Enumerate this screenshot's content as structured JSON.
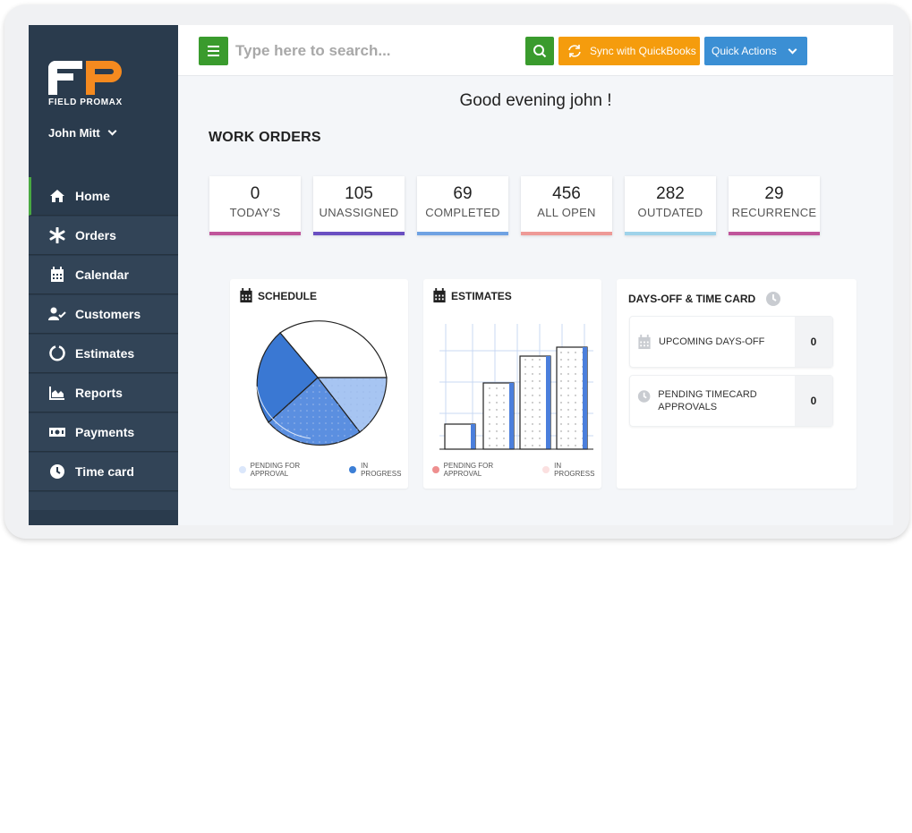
{
  "app": {
    "logo_text": "FIELD PROMAX",
    "user_name": "John Mitt"
  },
  "sidebar": {
    "items": [
      {
        "label": "Home",
        "icon": "home-icon",
        "active": true
      },
      {
        "label": "Orders",
        "icon": "asterisk-icon",
        "active": false
      },
      {
        "label": "Calendar",
        "icon": "calendar-icon",
        "active": false
      },
      {
        "label": "Customers",
        "icon": "user-check-icon",
        "active": false
      },
      {
        "label": "Estimates",
        "icon": "circle-notch-icon",
        "active": false
      },
      {
        "label": "Reports",
        "icon": "area-chart-icon",
        "active": false
      },
      {
        "label": "Payments",
        "icon": "money-bill-icon",
        "active": false
      },
      {
        "label": "Time card",
        "icon": "clock-icon",
        "active": false
      }
    ]
  },
  "topbar": {
    "search_placeholder": "Type here to search...",
    "sync_label": "Sync with QuickBooks",
    "quick_actions_label": "Quick Actions"
  },
  "main": {
    "greeting": "Good evening john !",
    "section_title": "WORK ORDERS",
    "stats": [
      {
        "value": "0",
        "label": "TODAY'S",
        "color": "#c0559b"
      },
      {
        "value": "105",
        "label": "UNASSIGNED",
        "color": "#6a4fc2"
      },
      {
        "value": "69",
        "label": "COMPLETED",
        "color": "#6fa2e3"
      },
      {
        "value": "456",
        "label": "ALL OPEN",
        "color": "#ee9a97"
      },
      {
        "value": "282",
        "label": "OUTDATED",
        "color": "#9fd3ea"
      },
      {
        "value": "29",
        "label": "RECURRENCE",
        "color": "#c0559b"
      }
    ]
  },
  "schedule": {
    "title": "SCHEDULE",
    "legend": [
      {
        "label": "PENDING FOR APPROVAL",
        "color": "#dbe7fb"
      },
      {
        "label": "IN PROGRESS",
        "color": "#3d7fd6"
      }
    ]
  },
  "estimates": {
    "title": "ESTIMATES",
    "legend": [
      {
        "label": "PENDING FOR APPROVAL",
        "color": "#ee8f8f"
      },
      {
        "label": "IN PROGRESS",
        "color": "#fbe0e0"
      }
    ]
  },
  "daysoff": {
    "title": "DAYS-OFF & TIME CARD",
    "rows": [
      {
        "label": "UPCOMING DAYS-OFF",
        "value": "0",
        "icon": "calendar-icon"
      },
      {
        "label": "PENDING TIMECARD APPROVALS",
        "value": "0",
        "icon": "clock-icon"
      }
    ]
  },
  "chart_data": [
    {
      "type": "pie",
      "title": "SCHEDULE",
      "legend": [
        "PENDING FOR APPROVAL",
        "IN PROGRESS"
      ]
    },
    {
      "type": "bar",
      "title": "ESTIMATES",
      "legend": [
        "PENDING FOR APPROVAL",
        "IN PROGRESS"
      ]
    }
  ]
}
